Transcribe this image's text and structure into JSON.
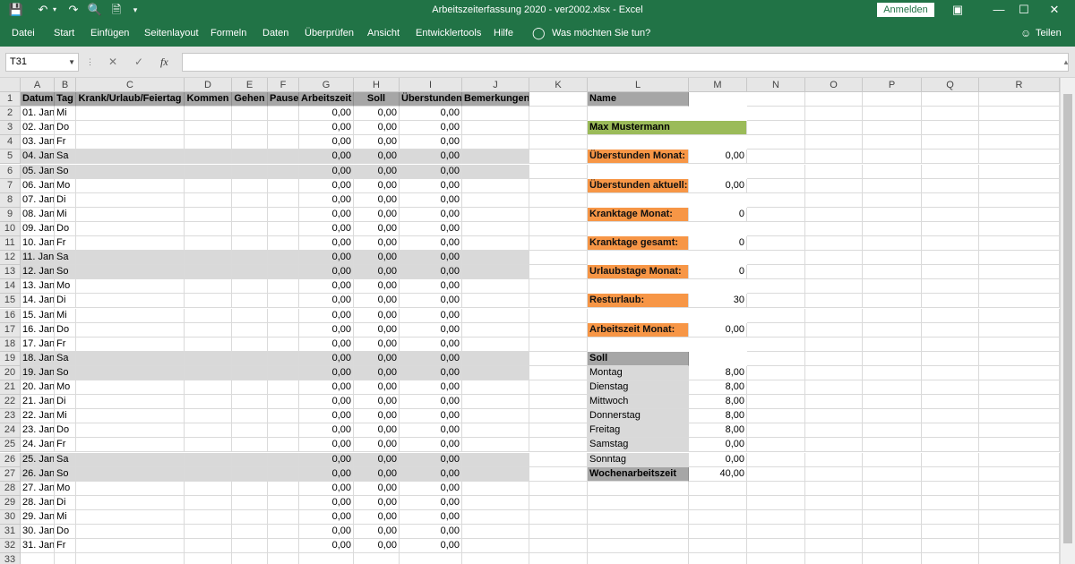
{
  "window": {
    "title": "Arbeitszeiterfassung 2020 - ver2002.xlsx  -  Excel",
    "signin": "Anmelden"
  },
  "ribbon": {
    "tabs": [
      "Datei",
      "Start",
      "Einfügen",
      "Seitenlayout",
      "Formeln",
      "Daten",
      "Überprüfen",
      "Ansicht",
      "Entwicklertools",
      "Hilfe"
    ],
    "tell_me": "Was möchten Sie tun?",
    "share": "Teilen"
  },
  "formula_bar": {
    "name_box": "T31",
    "fx": "fx",
    "value": ""
  },
  "columns": [
    "A",
    "B",
    "C",
    "D",
    "E",
    "F",
    "G",
    "H",
    "I",
    "J",
    "K",
    "L",
    "M",
    "N",
    "O",
    "P",
    "Q",
    "R"
  ],
  "rows": [
    "1",
    "2",
    "3",
    "4",
    "5",
    "6",
    "7",
    "8",
    "9",
    "10",
    "11",
    "12",
    "13",
    "14",
    "15",
    "16",
    "17",
    "18",
    "19",
    "20",
    "21",
    "22",
    "23",
    "24",
    "25",
    "26",
    "27",
    "28",
    "29",
    "30",
    "31",
    "32",
    "33"
  ],
  "table_headers": [
    "Datum",
    "Tag",
    "Krank/Urlaub/Feiertag",
    "Kommen",
    "Gehen",
    "Pause",
    "Arbeitszeit",
    "Soll",
    "Überstunden",
    "Bemerkungen"
  ],
  "days": [
    {
      "date": "01. Jan",
      "day": "Mi",
      "weekend": false
    },
    {
      "date": "02. Jan",
      "day": "Do",
      "weekend": false
    },
    {
      "date": "03. Jan",
      "day": "Fr",
      "weekend": false
    },
    {
      "date": "04. Jan",
      "day": "Sa",
      "weekend": true
    },
    {
      "date": "05. Jan",
      "day": "So",
      "weekend": true
    },
    {
      "date": "06. Jan",
      "day": "Mo",
      "weekend": false
    },
    {
      "date": "07. Jan",
      "day": "Di",
      "weekend": false
    },
    {
      "date": "08. Jan",
      "day": "Mi",
      "weekend": false
    },
    {
      "date": "09. Jan",
      "day": "Do",
      "weekend": false
    },
    {
      "date": "10. Jan",
      "day": "Fr",
      "weekend": false
    },
    {
      "date": "11. Jan",
      "day": "Sa",
      "weekend": true
    },
    {
      "date": "12. Jan",
      "day": "So",
      "weekend": true
    },
    {
      "date": "13. Jan",
      "day": "Mo",
      "weekend": false
    },
    {
      "date": "14. Jan",
      "day": "Di",
      "weekend": false
    },
    {
      "date": "15. Jan",
      "day": "Mi",
      "weekend": false
    },
    {
      "date": "16. Jan",
      "day": "Do",
      "weekend": false
    },
    {
      "date": "17. Jan",
      "day": "Fr",
      "weekend": false
    },
    {
      "date": "18. Jan",
      "day": "Sa",
      "weekend": true
    },
    {
      "date": "19. Jan",
      "day": "So",
      "weekend": true
    },
    {
      "date": "20. Jan",
      "day": "Mo",
      "weekend": false
    },
    {
      "date": "21. Jan",
      "day": "Di",
      "weekend": false
    },
    {
      "date": "22. Jan",
      "day": "Mi",
      "weekend": false
    },
    {
      "date": "23. Jan",
      "day": "Do",
      "weekend": false
    },
    {
      "date": "24. Jan",
      "day": "Fr",
      "weekend": false
    },
    {
      "date": "25. Jan",
      "day": "Sa",
      "weekend": true
    },
    {
      "date": "26. Jan",
      "day": "So",
      "weekend": true
    },
    {
      "date": "27. Jan",
      "day": "Mo",
      "weekend": false
    },
    {
      "date": "28. Jan",
      "day": "Di",
      "weekend": false
    },
    {
      "date": "29. Jan",
      "day": "Mi",
      "weekend": false
    },
    {
      "date": "30. Jan",
      "day": "Do",
      "weekend": false
    },
    {
      "date": "31. Jan",
      "day": "Fr",
      "weekend": false
    }
  ],
  "zero_value": "0,00",
  "summary": {
    "name_label": "Name",
    "name_value": "Max Mustermann",
    "items": [
      {
        "label": "Überstunden Monat:",
        "value": "0,00"
      },
      {
        "label": "Überstunden aktuell:",
        "value": "0,00"
      },
      {
        "label": "Kranktage Monat:",
        "value": "0"
      },
      {
        "label": "Kranktage gesamt:",
        "value": "0"
      },
      {
        "label": "Urlaubstage Monat:",
        "value": "0"
      },
      {
        "label": "Resturlaub:",
        "value": "30"
      },
      {
        "label": "Arbeitszeit Monat:",
        "value": "0,00"
      }
    ],
    "soll_label": "Soll",
    "soll": [
      {
        "day": "Montag",
        "value": "8,00"
      },
      {
        "day": "Dienstag",
        "value": "8,00"
      },
      {
        "day": "Mittwoch",
        "value": "8,00"
      },
      {
        "day": "Donnerstag",
        "value": "8,00"
      },
      {
        "day": "Freitag",
        "value": "8,00"
      },
      {
        "day": "Samstag",
        "value": "0,00"
      },
      {
        "day": "Sonntag",
        "value": "0,00"
      }
    ],
    "week_label": "Wochenarbeitszeit",
    "week_value": "40,00"
  },
  "colors": {
    "excel_green": "#217346",
    "header_gray": "#a6a6a6",
    "weekend_gray": "#d9d9d9",
    "label_orange": "#f79646",
    "name_green": "#9bbb59"
  }
}
